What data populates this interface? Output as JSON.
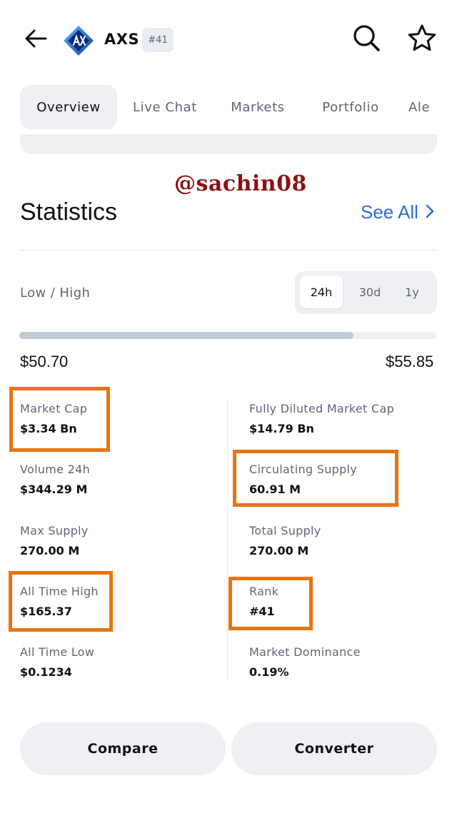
{
  "header": {
    "coin_name": "AXS",
    "rank_badge": "#41",
    "icons": {
      "back": "arrow-left-icon",
      "search": "search-icon",
      "favorite": "star-icon",
      "logo": "axie-infinity-logo"
    }
  },
  "tabs": [
    {
      "label": "Overview",
      "active": true
    },
    {
      "label": "Live Chat",
      "active": false
    },
    {
      "label": "Markets",
      "active": false
    },
    {
      "label": "Portfolio",
      "active": false
    },
    {
      "label": "Ale",
      "active": false
    }
  ],
  "watermark": "@sachin08",
  "statistics": {
    "title": "Statistics",
    "see_all": "See All",
    "low_high_label": "Low / High",
    "periods": [
      {
        "label": "24h",
        "active": true
      },
      {
        "label": "30d",
        "active": false
      },
      {
        "label": "1y",
        "active": false
      }
    ],
    "range_fraction": 0.8,
    "low": "$50.70",
    "high": "$55.85",
    "left": [
      {
        "label": "Market Cap",
        "value": "$3.34 Bn"
      },
      {
        "label": "Volume 24h",
        "value": "$344.29 M"
      },
      {
        "label": "Max Supply",
        "value": "270.00 M"
      },
      {
        "label": "All Time High",
        "value": "$165.37"
      },
      {
        "label": "All Time Low",
        "value": "$0.1234"
      }
    ],
    "right": [
      {
        "label": "Fully Diluted Market Cap",
        "value": "$14.79 Bn"
      },
      {
        "label": "Circulating Supply",
        "value": "60.91 M"
      },
      {
        "label": "Total Supply",
        "value": "270.00 M"
      },
      {
        "label": "Rank",
        "value": "#41"
      },
      {
        "label": "Market Dominance",
        "value": "0.19%"
      }
    ]
  },
  "actions": {
    "compare": "Compare",
    "converter": "Converter"
  },
  "colors": {
    "accent_link": "#2f6fde",
    "highlight_box": "#e8750f",
    "watermark": "#8a1212",
    "chip_bg": "#eef0f4"
  }
}
